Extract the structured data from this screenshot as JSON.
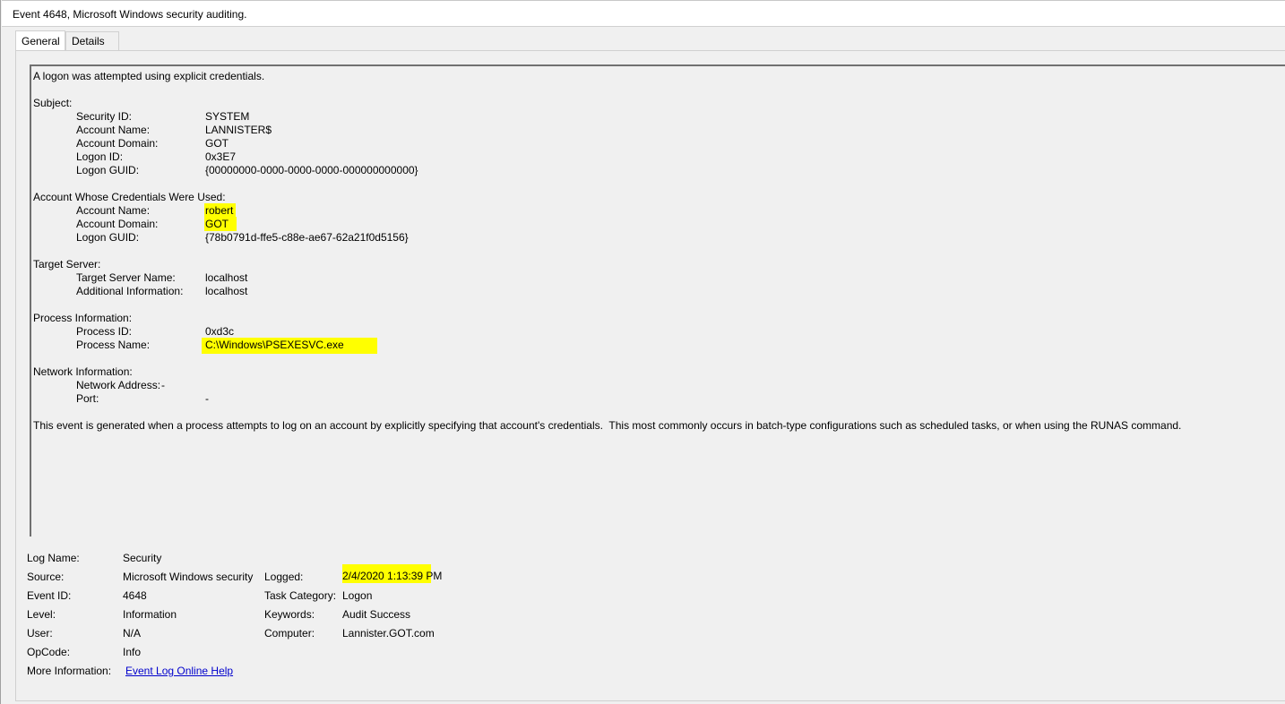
{
  "window": {
    "title": "Event 4648, Microsoft Windows security auditing."
  },
  "tabs": [
    {
      "label": "General",
      "active": true
    },
    {
      "label": "Details",
      "active": false
    }
  ],
  "message": {
    "intro": "A logon was attempted using explicit credentials.",
    "subject": {
      "heading": "Subject:",
      "fields": [
        {
          "label": "Security ID:",
          "value": "SYSTEM"
        },
        {
          "label": "Account Name:",
          "value": "LANNISTER$"
        },
        {
          "label": "Account Domain:",
          "value": "GOT"
        },
        {
          "label": "Logon ID:",
          "value": "0x3E7"
        },
        {
          "label": "Logon GUID:",
          "value": "{00000000-0000-0000-0000-000000000000}"
        }
      ]
    },
    "credentials": {
      "heading": "Account Whose Credentials Were Used:",
      "fields": [
        {
          "label": "Account Name:",
          "value": "robert"
        },
        {
          "label": "Account Domain:",
          "value": "GOT"
        },
        {
          "label": "Logon GUID:",
          "value": "{78b0791d-ffe5-c88e-ae67-62a21f0d5156}"
        }
      ]
    },
    "target": {
      "heading": "Target Server:",
      "fields": [
        {
          "label": "Target Server Name:",
          "value": "localhost"
        },
        {
          "label": "Additional Information:",
          "value": "localhost"
        }
      ]
    },
    "process": {
      "heading": "Process Information:",
      "fields": [
        {
          "label": "Process ID:",
          "value": "0xd3c"
        },
        {
          "label": "Process Name:",
          "value": "C:\\Windows\\PSEXESVC.exe"
        }
      ]
    },
    "network": {
      "heading": "Network Information:",
      "fields": [
        {
          "label": "Network Address:",
          "value": "-"
        },
        {
          "label": "Port:",
          "value": "-"
        }
      ]
    },
    "footer": "This event is generated when a process attempts to log on an account by explicitly specifying that account's credentials.  This most commonly occurs in batch-type configurations such as scheduled tasks, or when using the RUNAS command."
  },
  "properties": {
    "log_name": {
      "label": "Log Name:",
      "value": "Security"
    },
    "source": {
      "label": "Source:",
      "value": "Microsoft Windows security"
    },
    "logged": {
      "label": "Logged:",
      "value": "2/4/2020 1:13:39 PM"
    },
    "event_id": {
      "label": "Event ID:",
      "value": "4648"
    },
    "task_category": {
      "label": "Task Category:",
      "value": "Logon"
    },
    "level": {
      "label": "Level:",
      "value": "Information"
    },
    "keywords": {
      "label": "Keywords:",
      "value": "Audit Success"
    },
    "user": {
      "label": "User:",
      "value": "N/A"
    },
    "computer": {
      "label": "Computer:",
      "value": "Lannister.GOT.com"
    },
    "opcode": {
      "label": "OpCode:",
      "value": "Info"
    },
    "more_info": {
      "label": "More Information:",
      "link_text": "Event Log Online Help"
    }
  },
  "highlight_color": "#ffff00"
}
